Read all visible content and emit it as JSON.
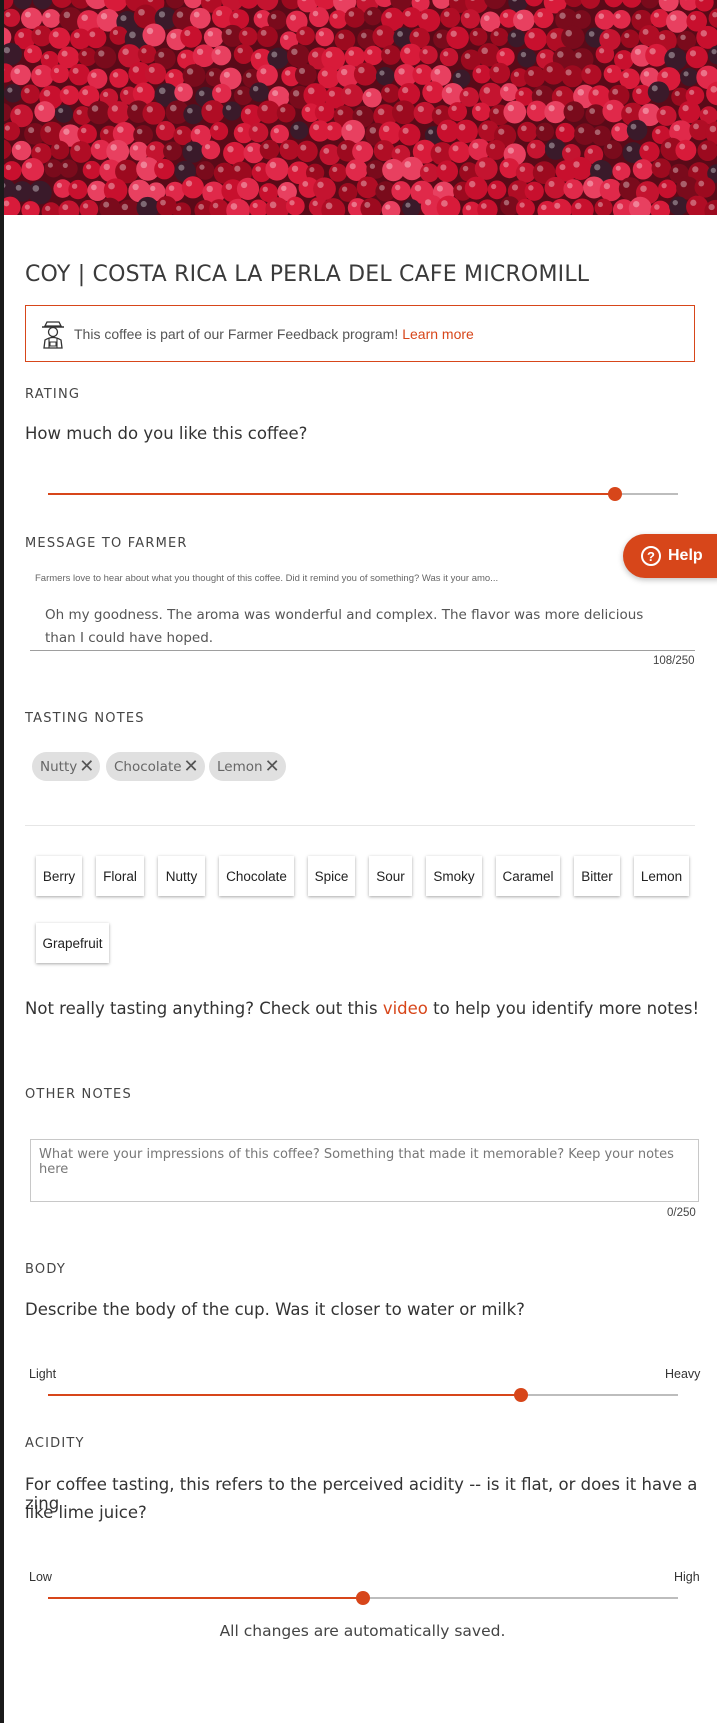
{
  "colors": {
    "accent": "#d7461a",
    "track": "#bdbdbd",
    "chip_bg": "#e0e0e0"
  },
  "hero": {
    "image": "coffee-cherries-photo"
  },
  "title": "COY | COSTA RICA LA PERLA DEL CAFE MICROMILL",
  "notice": {
    "icon": "farmer-icon",
    "text": "This coffee is part of our Farmer Feedback program!",
    "link": "Learn more"
  },
  "rating": {
    "label": "RATING",
    "question": "How much do you like this coffee?",
    "value": 0.9
  },
  "message": {
    "label": "MESSAGE TO FARMER",
    "hint": "Farmers love to hear about what you thought of this coffee. Did it remind you of something? Was it your amo...",
    "text": "Oh my goodness. The aroma was wonderful and complex. The flavor was more delicious than I could have hoped.",
    "counter": "108/250"
  },
  "help": {
    "label": "Help",
    "icon": "question-circle-icon"
  },
  "tasting": {
    "label": "TASTING NOTES",
    "selected": [
      "Nutty",
      "Chocolate",
      "Lemon"
    ],
    "options": [
      "Berry",
      "Floral",
      "Nutty",
      "Chocolate",
      "Spice",
      "Sour",
      "Smoky",
      "Caramel",
      "Bitter",
      "Lemon",
      "Grapefruit"
    ],
    "video_prefix": "Not really tasting anything? Check out this ",
    "video_link": "video",
    "video_suffix": " to help you identify more notes!"
  },
  "other": {
    "label": "OTHER NOTES",
    "placeholder": "What were your impressions of this coffee? Something that made it memorable? Keep your notes here",
    "counter": "0/250"
  },
  "body": {
    "label": "BODY",
    "question": "Describe the body of the cup. Was it closer to water or milk?",
    "min_label": "Light",
    "max_label": "Heavy",
    "value": 0.75
  },
  "acidity": {
    "label": "ACIDITY",
    "question_line1": "For coffee tasting, this refers to the perceived acidity -- is it flat, or does it have a zing",
    "question_line2": "like lime juice?",
    "min_label": "Low",
    "max_label": "High",
    "value": 0.5
  },
  "status": "All changes are automatically saved."
}
